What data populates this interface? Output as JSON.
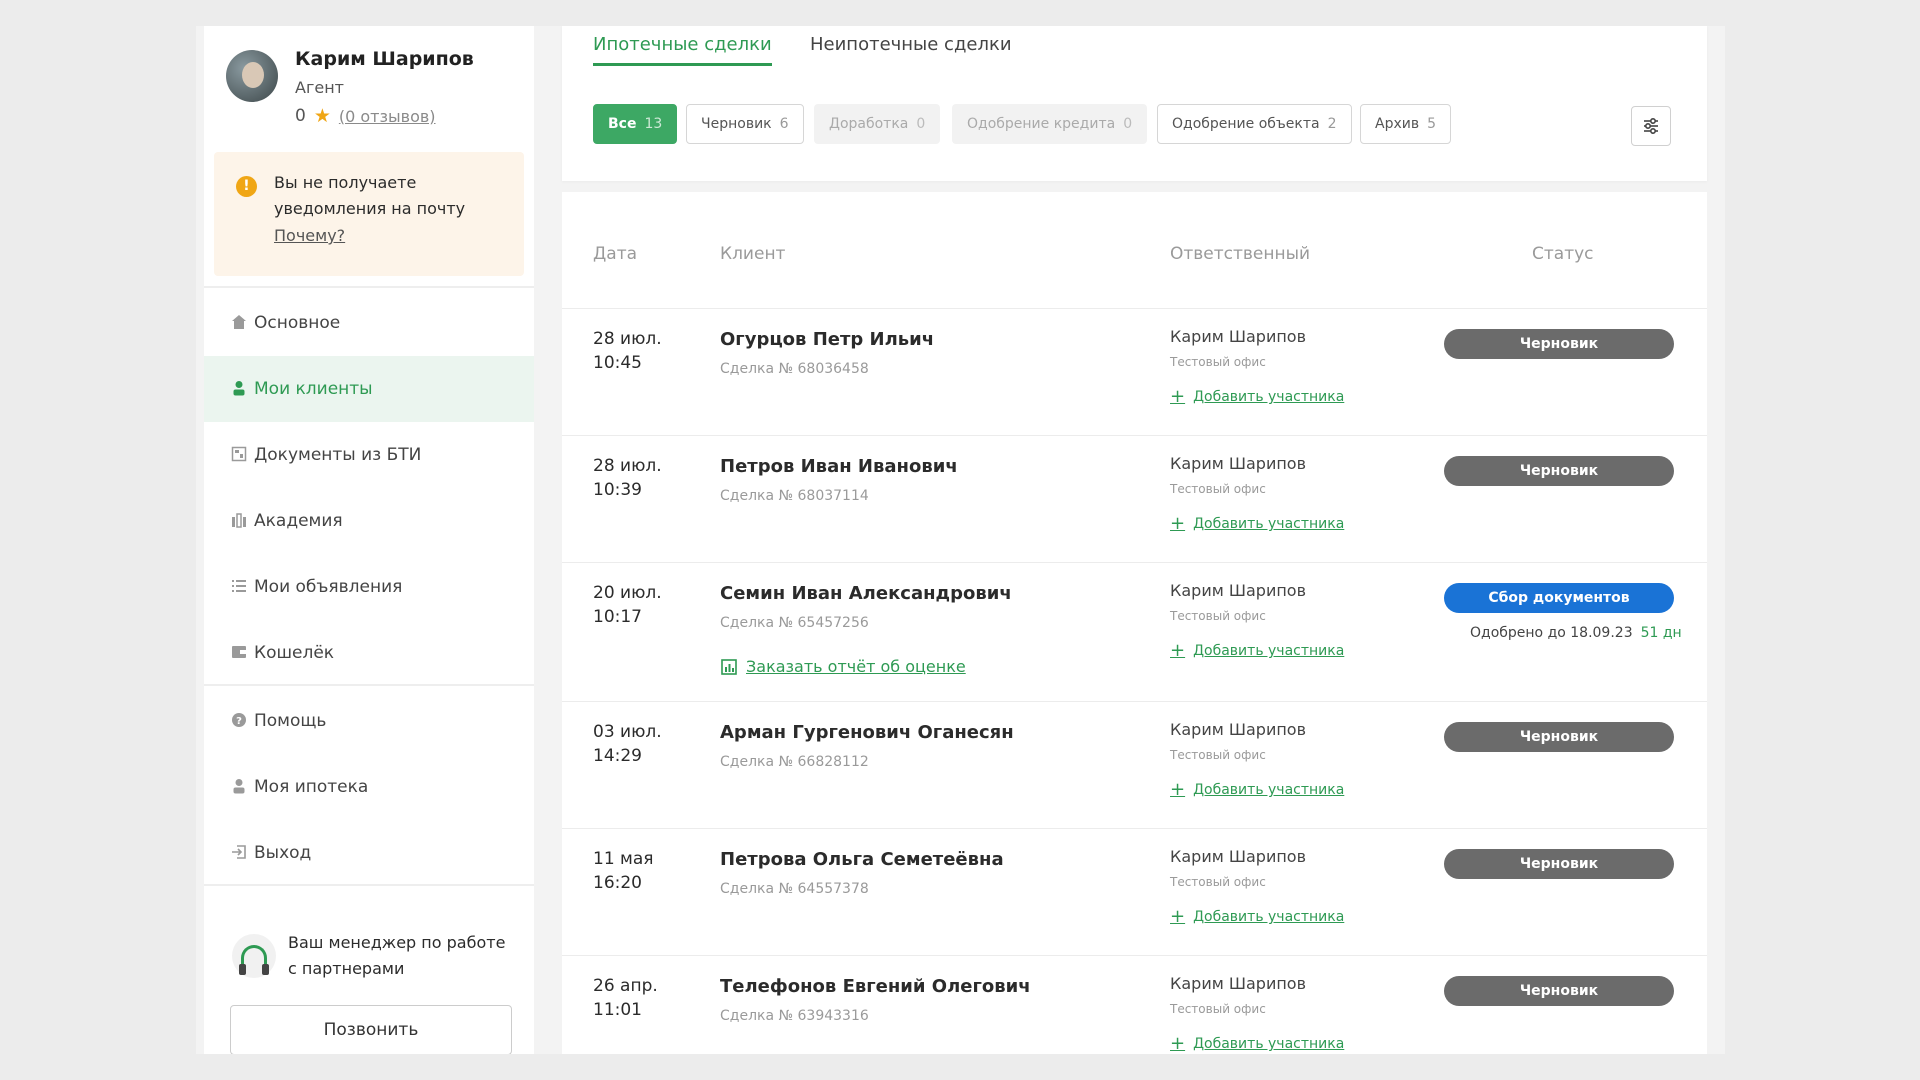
{
  "profile": {
    "name": "Карим Шарипов",
    "role": "Агент",
    "rating": "0",
    "reviews": "(0 отзывов)"
  },
  "notice": {
    "text": "Вы не получаете уведомления на почту",
    "link": "Почему?"
  },
  "nav": [
    {
      "label": "Основное",
      "icon": "home-icon"
    },
    {
      "label": "Мои клиенты",
      "icon": "user-icon",
      "active": true
    },
    {
      "label": "Документы из БТИ",
      "icon": "document-icon"
    },
    {
      "label": "Академия",
      "icon": "academy-icon"
    },
    {
      "label": "Мои объявления",
      "icon": "list-icon"
    },
    {
      "label": "Кошелёк",
      "icon": "wallet-icon"
    },
    {
      "label": "Помощь",
      "icon": "help-icon"
    },
    {
      "label": "Моя ипотека",
      "icon": "person-icon"
    },
    {
      "label": "Выход",
      "icon": "logout-icon"
    }
  ],
  "manager": {
    "text": "Ваш менеджер по работе с партнерами",
    "call_label": "Позвонить"
  },
  "tabs": [
    {
      "label": "Ипотечные сделки",
      "active": true
    },
    {
      "label": "Неипотечные сделки",
      "active": false
    }
  ],
  "chips": [
    {
      "label": "Все",
      "count": "13",
      "state": "active"
    },
    {
      "label": "Черновик",
      "count": "6",
      "state": "normal"
    },
    {
      "label": "Доработка",
      "count": "0",
      "state": "disabled"
    },
    {
      "label": "Одобрение кредита",
      "count": "0",
      "state": "disabled"
    },
    {
      "label": "Одобрение объекта",
      "count": "2",
      "state": "normal"
    },
    {
      "label": "Архив",
      "count": "5",
      "state": "normal"
    }
  ],
  "table": {
    "columns": {
      "date": "Дата",
      "client": "Клиент",
      "responsible": "Ответственный",
      "status": "Статус"
    },
    "rows": [
      {
        "date": "28 июл.",
        "time": "10:45",
        "client": "Огурцов Петр Ильич",
        "deal": "Сделка № 68036458",
        "responsible": "Карим Шарипов",
        "office": "Тестовый офис",
        "add": "Добавить участника",
        "status": "Черновик",
        "status_type": "draft"
      },
      {
        "date": "28 июл.",
        "time": "10:39",
        "client": "Петров Иван Иванович",
        "deal": "Сделка № 68037114",
        "responsible": "Карим Шарипов",
        "office": "Тестовый офис",
        "add": "Добавить участника",
        "status": "Черновик",
        "status_type": "draft"
      },
      {
        "date": "20 июл.",
        "time": "10:17",
        "client": "Семин Иван Александрович",
        "deal": "Сделка № 65457256",
        "report": "Заказать отчёт об оценке",
        "responsible": "Карим Шарипов",
        "office": "Тестовый офис",
        "add": "Добавить участника",
        "status": "Сбор документов",
        "status_type": "collect",
        "approved": "Одобрено до 18.09.23",
        "days": "51 дн"
      },
      {
        "date": "03 июл.",
        "time": "14:29",
        "client": "Арман Гургенович Оганесян",
        "deal": "Сделка № 66828112",
        "responsible": "Карим Шарипов",
        "office": "Тестовый офис",
        "add": "Добавить участника",
        "status": "Черновик",
        "status_type": "draft"
      },
      {
        "date": "11 мая",
        "time": "16:20",
        "client": "Петрова Ольга Семетеёвна",
        "deal": "Сделка № 64557378",
        "responsible": "Карим Шарипов",
        "office": "Тестовый офис",
        "add": "Добавить участника",
        "status": "Черновик",
        "status_type": "draft"
      },
      {
        "date": "26 апр.",
        "time": "11:01",
        "client": "Телефонов Евгений Олегович",
        "deal": "Сделка № 63943316",
        "responsible": "Карим Шарипов",
        "office": "Тестовый офис",
        "add": "Добавить участника",
        "status": "Черновик",
        "status_type": "draft"
      }
    ]
  },
  "colors": {
    "accent": "#2e9a53",
    "draft": "#6b6b6b",
    "collect": "#1a73d6",
    "warning": "#f0a615"
  }
}
